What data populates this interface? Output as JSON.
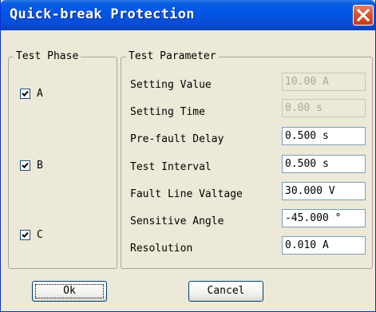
{
  "window": {
    "title": "Quick-break Protection"
  },
  "phase_group": {
    "label": "Test Phase",
    "phases": [
      {
        "label": "A",
        "checked": true
      },
      {
        "label": "B",
        "checked": true
      },
      {
        "label": "C",
        "checked": true
      }
    ]
  },
  "param_group": {
    "label": "Test Parameter",
    "params": [
      {
        "label": "Setting Value",
        "value": "10.00 A",
        "enabled": false
      },
      {
        "label": "Setting Time",
        "value": "0.00 s",
        "enabled": false
      },
      {
        "label": "Pre-fault Delay",
        "value": "0.500 s",
        "enabled": true
      },
      {
        "label": "Test Interval",
        "value": "0.500 s",
        "enabled": true
      },
      {
        "label": "Fault Line Valtage",
        "value": "30.000 V",
        "enabled": true
      },
      {
        "label": "Sensitive Angle",
        "value": "-45.000 °",
        "enabled": true
      },
      {
        "label": "Resolution",
        "value": "0.010 A",
        "enabled": true
      }
    ]
  },
  "buttons": {
    "ok": "Ok",
    "cancel": "Cancel"
  }
}
